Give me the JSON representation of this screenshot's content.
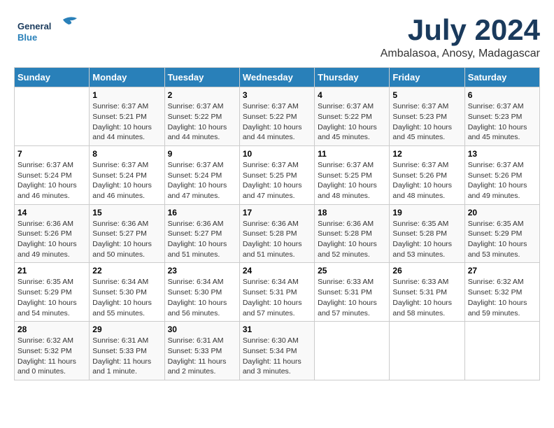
{
  "logo": {
    "general": "General",
    "blue": "Blue"
  },
  "title": "July 2024",
  "subtitle": "Ambalasoa, Anosy, Madagascar",
  "header_days": [
    "Sunday",
    "Monday",
    "Tuesday",
    "Wednesday",
    "Thursday",
    "Friday",
    "Saturday"
  ],
  "weeks": [
    [
      {
        "day": "",
        "info": ""
      },
      {
        "day": "1",
        "info": "Sunrise: 6:37 AM\nSunset: 5:21 PM\nDaylight: 10 hours\nand 44 minutes."
      },
      {
        "day": "2",
        "info": "Sunrise: 6:37 AM\nSunset: 5:22 PM\nDaylight: 10 hours\nand 44 minutes."
      },
      {
        "day": "3",
        "info": "Sunrise: 6:37 AM\nSunset: 5:22 PM\nDaylight: 10 hours\nand 44 minutes."
      },
      {
        "day": "4",
        "info": "Sunrise: 6:37 AM\nSunset: 5:22 PM\nDaylight: 10 hours\nand 45 minutes."
      },
      {
        "day": "5",
        "info": "Sunrise: 6:37 AM\nSunset: 5:23 PM\nDaylight: 10 hours\nand 45 minutes."
      },
      {
        "day": "6",
        "info": "Sunrise: 6:37 AM\nSunset: 5:23 PM\nDaylight: 10 hours\nand 45 minutes."
      }
    ],
    [
      {
        "day": "7",
        "info": "Sunrise: 6:37 AM\nSunset: 5:24 PM\nDaylight: 10 hours\nand 46 minutes."
      },
      {
        "day": "8",
        "info": "Sunrise: 6:37 AM\nSunset: 5:24 PM\nDaylight: 10 hours\nand 46 minutes."
      },
      {
        "day": "9",
        "info": "Sunrise: 6:37 AM\nSunset: 5:24 PM\nDaylight: 10 hours\nand 47 minutes."
      },
      {
        "day": "10",
        "info": "Sunrise: 6:37 AM\nSunset: 5:25 PM\nDaylight: 10 hours\nand 47 minutes."
      },
      {
        "day": "11",
        "info": "Sunrise: 6:37 AM\nSunset: 5:25 PM\nDaylight: 10 hours\nand 48 minutes."
      },
      {
        "day": "12",
        "info": "Sunrise: 6:37 AM\nSunset: 5:26 PM\nDaylight: 10 hours\nand 48 minutes."
      },
      {
        "day": "13",
        "info": "Sunrise: 6:37 AM\nSunset: 5:26 PM\nDaylight: 10 hours\nand 49 minutes."
      }
    ],
    [
      {
        "day": "14",
        "info": "Sunrise: 6:36 AM\nSunset: 5:26 PM\nDaylight: 10 hours\nand 49 minutes."
      },
      {
        "day": "15",
        "info": "Sunrise: 6:36 AM\nSunset: 5:27 PM\nDaylight: 10 hours\nand 50 minutes."
      },
      {
        "day": "16",
        "info": "Sunrise: 6:36 AM\nSunset: 5:27 PM\nDaylight: 10 hours\nand 51 minutes."
      },
      {
        "day": "17",
        "info": "Sunrise: 6:36 AM\nSunset: 5:28 PM\nDaylight: 10 hours\nand 51 minutes."
      },
      {
        "day": "18",
        "info": "Sunrise: 6:36 AM\nSunset: 5:28 PM\nDaylight: 10 hours\nand 52 minutes."
      },
      {
        "day": "19",
        "info": "Sunrise: 6:35 AM\nSunset: 5:28 PM\nDaylight: 10 hours\nand 53 minutes."
      },
      {
        "day": "20",
        "info": "Sunrise: 6:35 AM\nSunset: 5:29 PM\nDaylight: 10 hours\nand 53 minutes."
      }
    ],
    [
      {
        "day": "21",
        "info": "Sunrise: 6:35 AM\nSunset: 5:29 PM\nDaylight: 10 hours\nand 54 minutes."
      },
      {
        "day": "22",
        "info": "Sunrise: 6:34 AM\nSunset: 5:30 PM\nDaylight: 10 hours\nand 55 minutes."
      },
      {
        "day": "23",
        "info": "Sunrise: 6:34 AM\nSunset: 5:30 PM\nDaylight: 10 hours\nand 56 minutes."
      },
      {
        "day": "24",
        "info": "Sunrise: 6:34 AM\nSunset: 5:31 PM\nDaylight: 10 hours\nand 57 minutes."
      },
      {
        "day": "25",
        "info": "Sunrise: 6:33 AM\nSunset: 5:31 PM\nDaylight: 10 hours\nand 57 minutes."
      },
      {
        "day": "26",
        "info": "Sunrise: 6:33 AM\nSunset: 5:31 PM\nDaylight: 10 hours\nand 58 minutes."
      },
      {
        "day": "27",
        "info": "Sunrise: 6:32 AM\nSunset: 5:32 PM\nDaylight: 10 hours\nand 59 minutes."
      }
    ],
    [
      {
        "day": "28",
        "info": "Sunrise: 6:32 AM\nSunset: 5:32 PM\nDaylight: 11 hours\nand 0 minutes."
      },
      {
        "day": "29",
        "info": "Sunrise: 6:31 AM\nSunset: 5:33 PM\nDaylight: 11 hours\nand 1 minute."
      },
      {
        "day": "30",
        "info": "Sunrise: 6:31 AM\nSunset: 5:33 PM\nDaylight: 11 hours\nand 2 minutes."
      },
      {
        "day": "31",
        "info": "Sunrise: 6:30 AM\nSunset: 5:34 PM\nDaylight: 11 hours\nand 3 minutes."
      },
      {
        "day": "",
        "info": ""
      },
      {
        "day": "",
        "info": ""
      },
      {
        "day": "",
        "info": ""
      }
    ]
  ]
}
